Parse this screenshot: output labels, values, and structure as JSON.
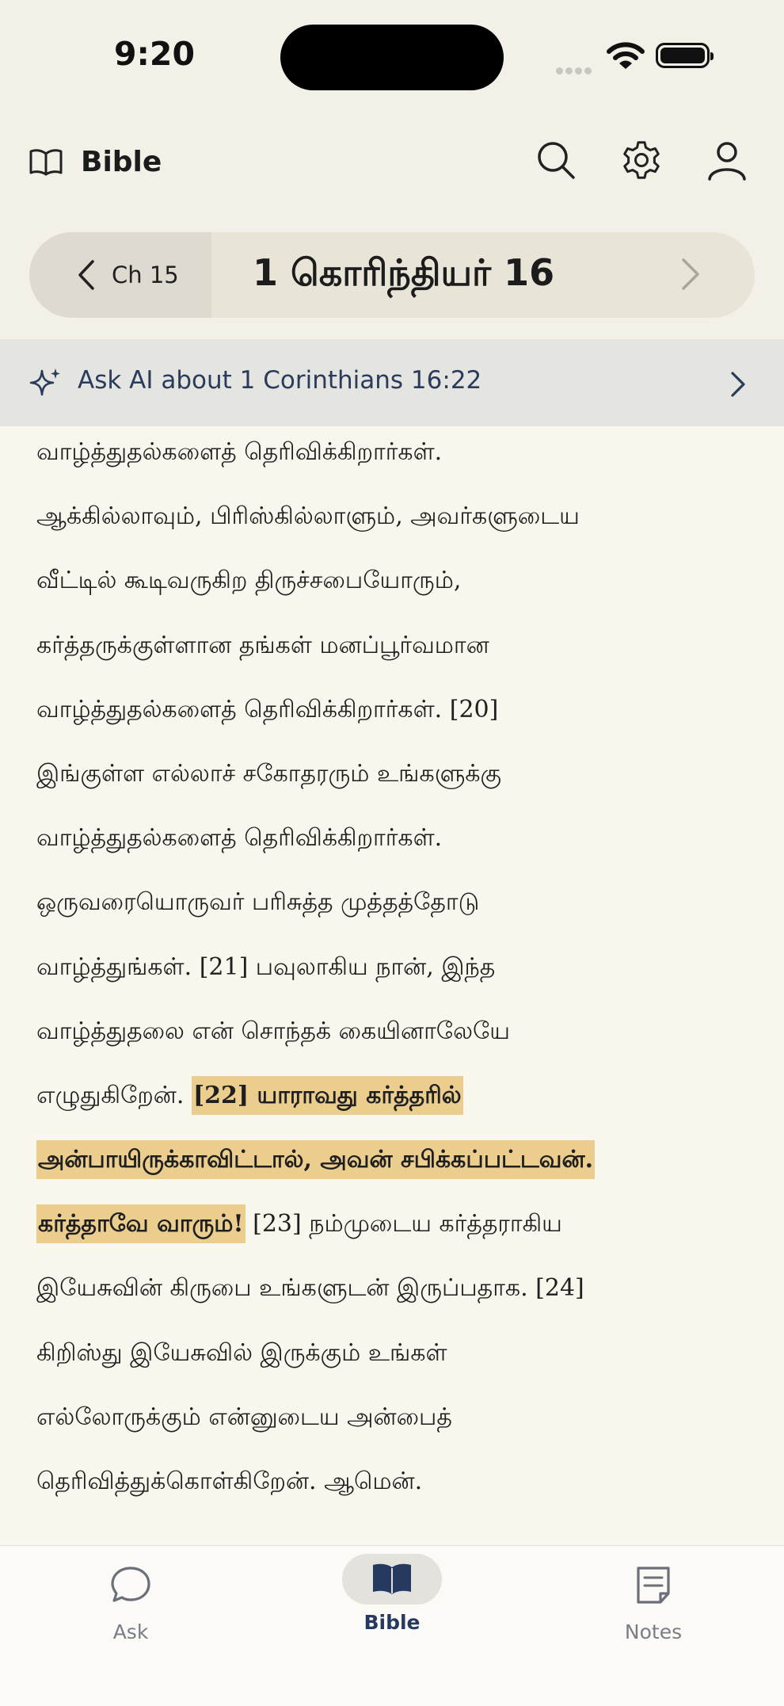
{
  "status": {
    "time": "9:20"
  },
  "header": {
    "title": "Bible"
  },
  "chapter_nav": {
    "prev_label": "Ch 15",
    "current": "1 கொரிந்தியர் 16"
  },
  "ask_ai": {
    "label": "Ask AI about 1 Corinthians 16:22"
  },
  "scripture": {
    "lines": [
      "வாழ்த்துதல்களைத் தெரிவிக்கிறார்கள்.",
      "ஆக்கில்லாவும், பிரிஸ்கில்லாளும், அவர்களுடைய",
      "வீட்டில் கூடிவருகிற திருச்சபையோரும்,",
      "கர்த்தருக்குள்ளான தங்கள் மனப்பூர்வமான",
      "வாழ்த்துதல்களைத் தெரிவிக்கிறார்கள். [20]",
      "இங்குள்ள எல்லாச் சகோதரரும் உங்களுக்கு",
      "வாழ்த்துதல்களைத் தெரிவிக்கிறார்கள்.",
      "ஒருவரையொருவர் பரிசுத்த முத்தத்தோடு",
      "வாழ்த்துங்கள். [21] பவுலாகிய நான், இந்த",
      "வாழ்த்துதலை என் சொந்தக் கையினாலேயே"
    ],
    "line11_pre": "எழுதுகிறேன். ",
    "line11_hl": "[22] யாராவது கர்த்தரில்",
    "line12_hl": "அன்பாயிருக்காவிட்டால், அவன் சபிக்கப்பட்டவன்.",
    "line13_hl": "கர்த்தாவே வாரும்!",
    "line13_post": " [23] நம்முடைய கர்த்தராகிய",
    "tail_lines": [
      "இயேசுவின் கிருபை உங்களுடன் இருப்பதாக. [24]",
      "கிறிஸ்து இயேசுவில் இருக்கும் உங்கள்",
      "எல்லோருக்கும் என்னுடைய அன்பைத்",
      "தெரிவித்துக்கொள்கிறேன். ஆமென்."
    ]
  },
  "tabs": [
    {
      "label": "Ask"
    },
    {
      "label": "Bible"
    },
    {
      "label": "Notes"
    }
  ],
  "colors": {
    "highlight": "#ebcd8d",
    "accent": "#2a3b5c",
    "background": "#f9f6ee"
  }
}
